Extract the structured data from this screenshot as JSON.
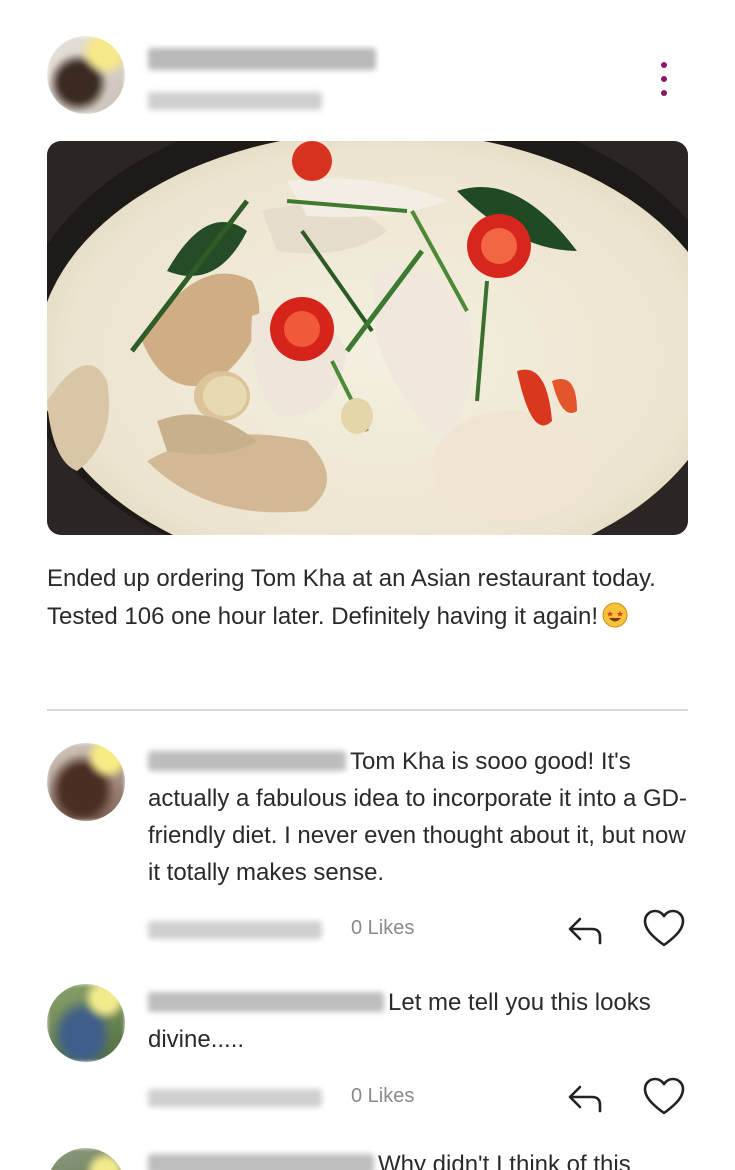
{
  "post": {
    "text": "Ended up ordering Tom Kha at an Asian restaurant today. Tested 106 one hour later. Definitely having it again!",
    "emoji": "grinning-face-with-star-eyes"
  },
  "comments": [
    {
      "text": "Tom Kha is sooo good! It's actually a fabulous idea to incorporate it into a GD-friendly diet. I never even thought about it, but now it totally makes sense.",
      "likes": "0 Likes"
    },
    {
      "text": "Let me tell you this looks divine.....",
      "likes": "0 Likes"
    },
    {
      "text": "Why didn't I think of this"
    }
  ],
  "icons": {
    "menu": "vertical-ellipsis-icon",
    "reply": "reply-arrow-icon",
    "like": "heart-outline-icon"
  },
  "colors": {
    "accent": "#8a1a66",
    "text": "#2a2a2a",
    "muted": "#8a8a8a",
    "divider": "#d9d9d9"
  }
}
